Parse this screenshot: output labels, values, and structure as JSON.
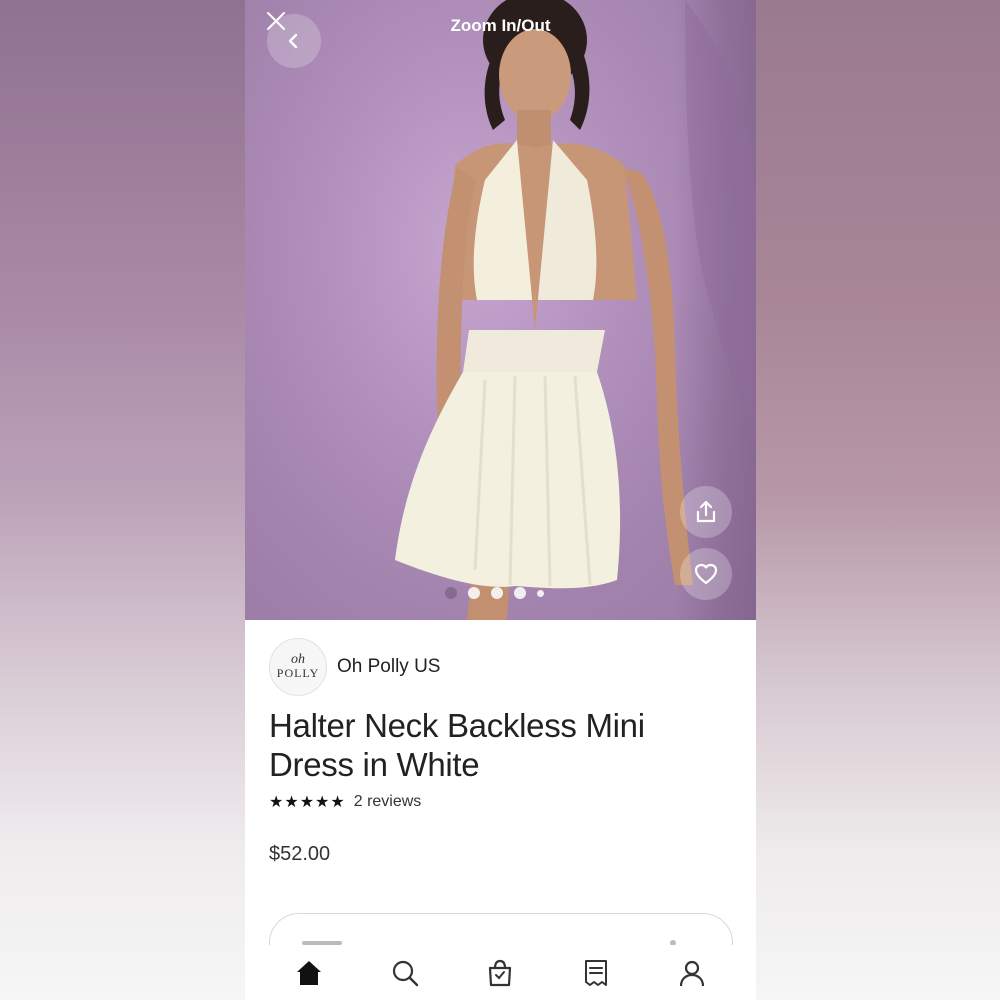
{
  "header": {
    "title": "Zoom In/Out",
    "close_icon": "close-icon",
    "back_icon": "chevron-left-icon"
  },
  "hero": {
    "image_description_icon": "product-photo",
    "share_icon": "share-icon",
    "like_icon": "heart-icon",
    "carousel": {
      "count": 5,
      "active_index": 0
    }
  },
  "shop": {
    "logo_line1": "oh",
    "logo_line2": "POLLY",
    "name": "Oh Polly US"
  },
  "product": {
    "title": "Halter Neck Backless Mini Dress in White",
    "stars": "★★★★★",
    "rating": 5,
    "reviews_label": "2 reviews",
    "price": "$52.00"
  },
  "tabbar": {
    "items": [
      {
        "name": "home",
        "icon": "home-icon",
        "active": true
      },
      {
        "name": "search",
        "icon": "search-icon",
        "active": false
      },
      {
        "name": "cart",
        "icon": "shopping-bag-icon",
        "active": false
      },
      {
        "name": "orders",
        "icon": "receipt-icon",
        "active": false
      },
      {
        "name": "account",
        "icon": "user-icon",
        "active": false
      }
    ]
  },
  "colors": {
    "hero_background": "#b08fbb",
    "text_primary": "#222222",
    "page_background": "#ffffff"
  }
}
